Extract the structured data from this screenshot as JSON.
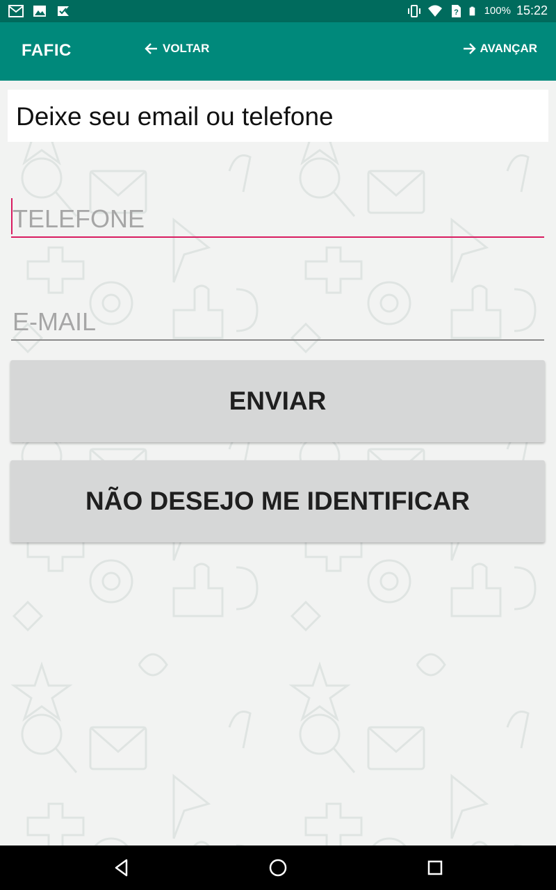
{
  "status_bar": {
    "battery": "100%",
    "time": "15:22",
    "icons": [
      "gmail-icon",
      "image-icon",
      "check-task-icon",
      "vibrate-icon",
      "wifi-icon",
      "no-sim-icon",
      "battery-icon"
    ]
  },
  "app_bar": {
    "title": "FAFIC",
    "back_label": "VOLTAR",
    "next_label": "AVANÇAR",
    "background": "#00897b"
  },
  "form": {
    "heading": "Deixe seu email ou telefone",
    "phone_placeholder": "TELEFONE",
    "email_placeholder": "E-MAIL",
    "send_label": "ENVIAR",
    "anonymous_label": "NÃO DESEJO ME IDENTIFICAR",
    "focus_color": "#d81b60"
  },
  "nav_bar": {
    "icons": [
      "back-triangle-icon",
      "home-circle-icon",
      "recents-square-icon"
    ]
  }
}
